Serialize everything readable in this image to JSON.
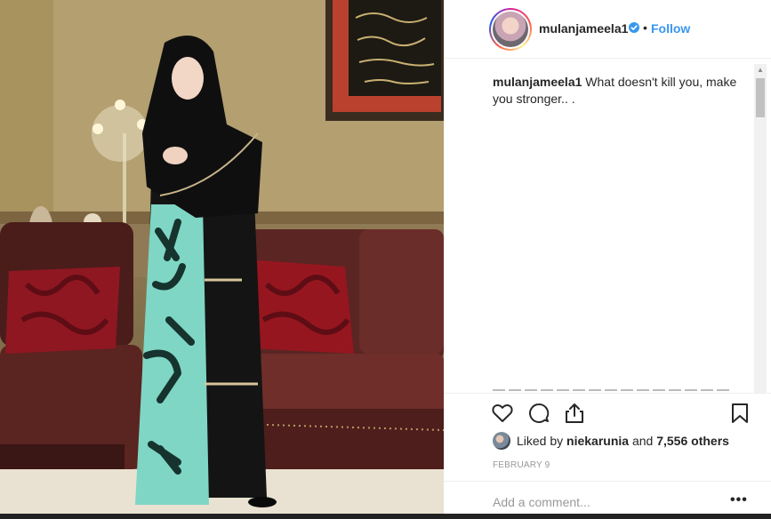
{
  "post": {
    "username": "mulanjameela1",
    "separator": "•",
    "follow_label": "Follow",
    "caption_user": "mulanjameela1",
    "caption_text": " What doesn't kill you, make you stronger.. .",
    "liked_by_prefix": "Liked by ",
    "liked_by_user": "niekarunia",
    "liked_by_mid": " and ",
    "liked_by_count": "7,556 others",
    "date": "FEBRUARY 9",
    "comment_placeholder": "Add a comment...",
    "more_label": "•••"
  },
  "icons": {
    "verified": "verified-badge-icon",
    "like": "heart-icon",
    "comment": "comment-bubble-icon",
    "share": "share-icon",
    "save": "bookmark-icon"
  },
  "colors": {
    "link_blue": "#3897f0",
    "text": "#262626",
    "muted": "#999999",
    "border": "#efefef"
  }
}
